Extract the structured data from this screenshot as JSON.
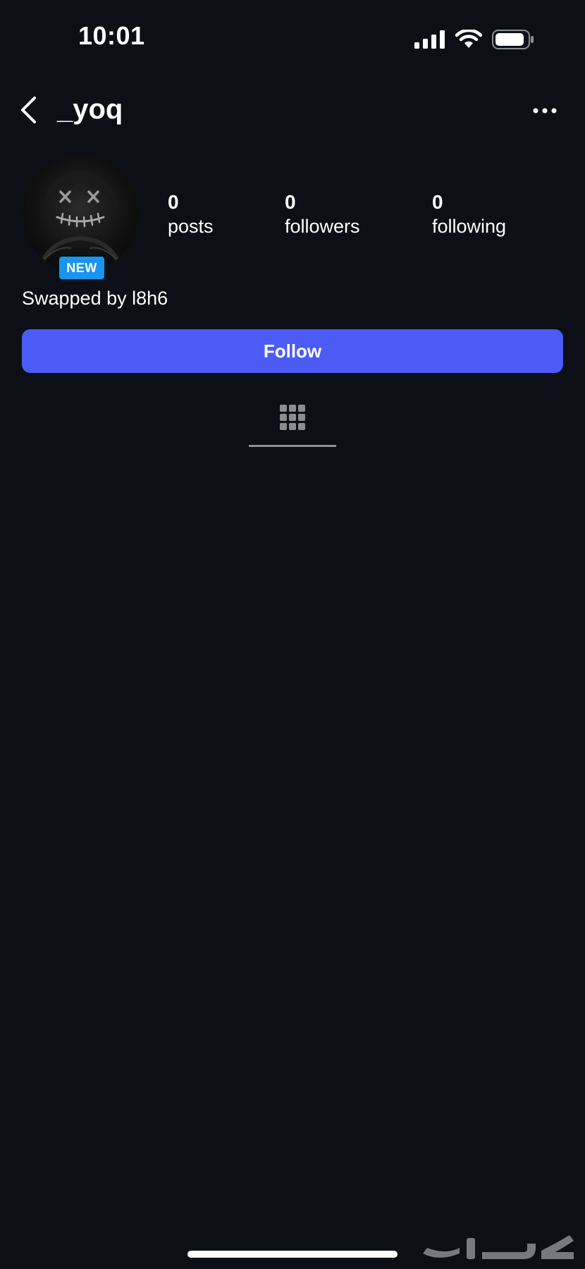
{
  "status_bar": {
    "time": "10:01",
    "icons": [
      "signal-icon",
      "wifi-icon",
      "battery-icon"
    ]
  },
  "header": {
    "back_icon": "chevron-left-icon",
    "username": "_yoq",
    "more_icon": "ellipsis-icon"
  },
  "profile": {
    "badge": "NEW",
    "stats": [
      {
        "value": "0",
        "label": "posts"
      },
      {
        "value": "0",
        "label": "followers"
      },
      {
        "value": "0",
        "label": "following"
      }
    ],
    "bio": "Swapped by l8h6",
    "follow_label": "Follow"
  },
  "tabs": {
    "active": "grid-icon"
  },
  "colors": {
    "background": "#0c1016",
    "follow_button": "#4d5bf5",
    "badge": "#1795f0"
  }
}
